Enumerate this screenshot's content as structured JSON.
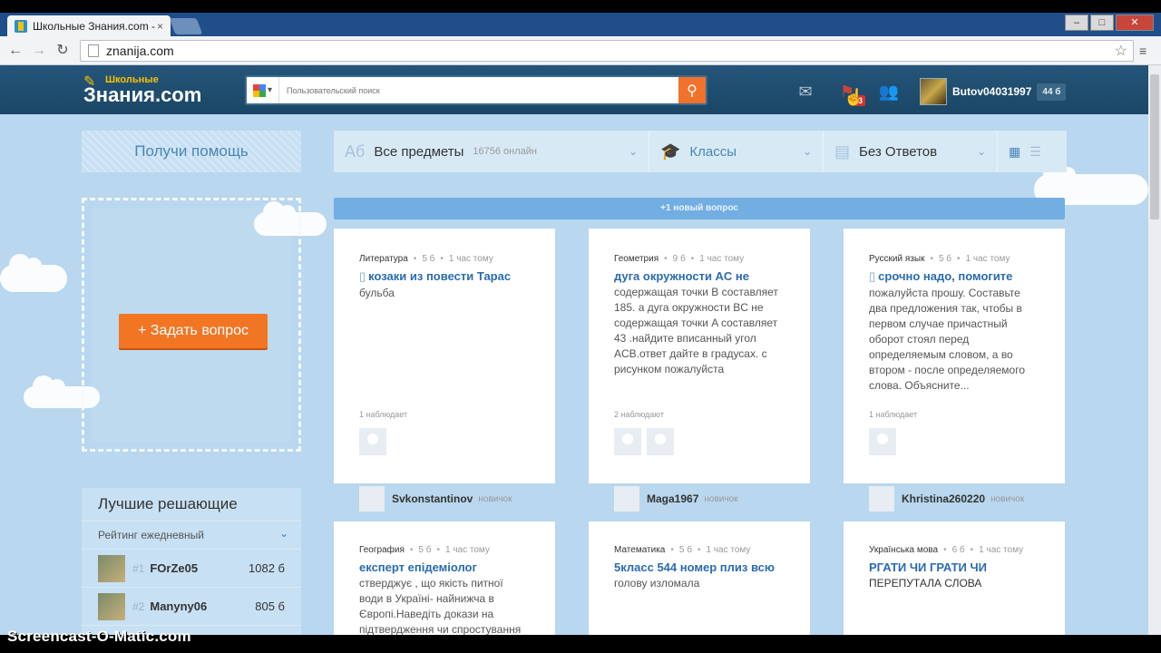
{
  "browser": {
    "tab_title": "Школьные Знания.com -",
    "tab_close": "×",
    "url": "znanija.com",
    "win_min": "–",
    "win_max": "□",
    "win_close": "✕",
    "back": "←",
    "forward": "→",
    "reload": "↻",
    "star": "☆",
    "menu": "≡"
  },
  "site": {
    "logo_small": "Школьные",
    "logo_big": "Знания.com",
    "search_placeholder": "Пользовательский поиск",
    "search_brand": "Google™",
    "notif_count": "3",
    "username": "Butov04031997",
    "points": "44 б"
  },
  "sidebar": {
    "help_tab": "Получи помощь",
    "ask_button": "Задать вопрос",
    "leaders_title": "Лучшие решающие",
    "rating_label": "Рейтинг ежедневный",
    "leaders": [
      {
        "rank": "#1",
        "name": "FOrZe05",
        "points": "1082 б"
      },
      {
        "rank": "#2",
        "name": "Manyny06",
        "points": "805 б"
      }
    ]
  },
  "filters": {
    "subjects_label": "Все предметы",
    "online_count": "16756 онлайн",
    "classes_label": "Классы",
    "unanswered_label": "Без Ответов"
  },
  "new_questions_banner": "+1 новый вопрос",
  "questions": [
    {
      "subject": "Литература",
      "points": "5 б",
      "time": "1 час тому",
      "title": "козаки из повести Тарас",
      "text": "бульба",
      "watchers_label": "1 наблюдает",
      "author": "Svkonstantinov",
      "role": "новичок"
    },
    {
      "subject": "Геометрия",
      "points": "9 б",
      "time": "1 час тому",
      "title": "дуга окружности AC не",
      "text": "содержащая точки B составляет 185. а дуга окружности BC не содержащая точки A составляет 43 .найдите вписанный угол ACB.ответ дайте в градусах. с рисунком пожалуйста",
      "watchers_label": "2 наблюдают",
      "author": "Maga1967",
      "role": "новичок"
    },
    {
      "subject": "Русский язык",
      "points": "5 б",
      "time": "1 час тому",
      "title": "срочно надо, помогите",
      "text": "пожалуйста прошу. Составьте два предложения так, чтобы в первом случае причастный оборот стоял перед определяемым словом, а во втором - после определяемого слова. Объясните...",
      "watchers_label": "1 наблюдает",
      "author": "Khristina260220",
      "role": "новичок"
    },
    {
      "subject": "География",
      "points": "5 б",
      "time": "1 час тому",
      "title": "експерт епідеміолог",
      "text": "стверджує , що якість питної води в Україні- найнижча в Європі.Наведіть докази на підтвердження чи спростування",
      "watchers_label": "",
      "author": "",
      "role": ""
    },
    {
      "subject": "Математика",
      "points": "5 б",
      "time": "1 час тому",
      "title": "5класс 544 номер плиз всю",
      "text": "голову изломала",
      "watchers_label": "",
      "author": "",
      "role": ""
    },
    {
      "subject": "Українська мова",
      "points": "6 б",
      "time": "1 час тому",
      "title": "РГАТИ ЧИ ГРАТИ ЧИ",
      "text": "ПЕРЕПУТАЛА СЛОВА",
      "watchers_label": "",
      "author": "",
      "role": ""
    }
  ],
  "watermark": "Screencast-O-Matic.com"
}
